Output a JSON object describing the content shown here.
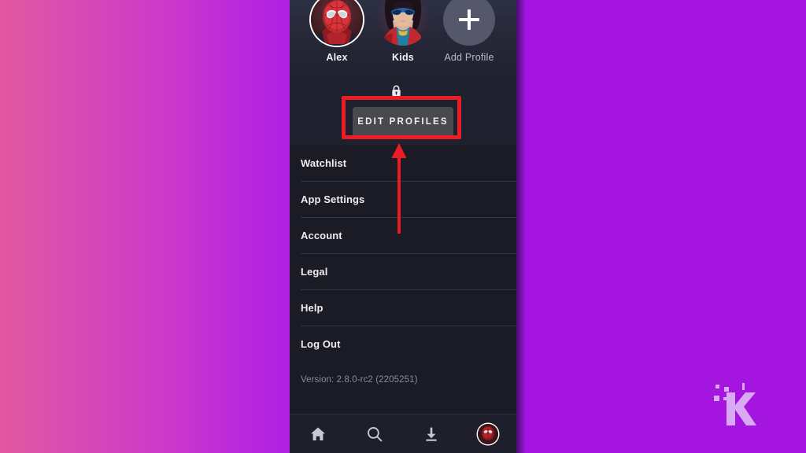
{
  "background": {
    "left_gradient_from": "#e2589f",
    "left_gradient_to": "#ae20e4",
    "right_color": "#a416e0"
  },
  "watermark": {
    "name": "knowtechie-k-logo",
    "color": "#d8a9f5"
  },
  "app": {
    "profiles": [
      {
        "name": "Alex",
        "avatar": "spiderman-avatar",
        "selected": true,
        "locked": true
      },
      {
        "name": "Kids",
        "avatar": "ms-marvel-avatar",
        "selected": false,
        "locked": false
      },
      {
        "name": "Add Profile",
        "avatar": "add-profile-plus-icon",
        "selected": false,
        "locked": false
      }
    ],
    "edit_profiles_label": "EDIT PROFILES",
    "menu": [
      {
        "label": "Watchlist"
      },
      {
        "label": "App Settings"
      },
      {
        "label": "Account"
      },
      {
        "label": "Legal"
      },
      {
        "label": "Help"
      },
      {
        "label": "Log Out"
      }
    ],
    "version_text": "Version: 2.8.0-rc2 (2205251)",
    "nav": [
      {
        "name": "home",
        "icon": "home-icon"
      },
      {
        "name": "search",
        "icon": "search-icon"
      },
      {
        "name": "downloads",
        "icon": "download-icon"
      },
      {
        "name": "profile",
        "icon": "profile-avatar-icon"
      }
    ]
  },
  "annotations": {
    "highlight_color": "#ec1c24",
    "target": "EDIT PROFILES"
  }
}
